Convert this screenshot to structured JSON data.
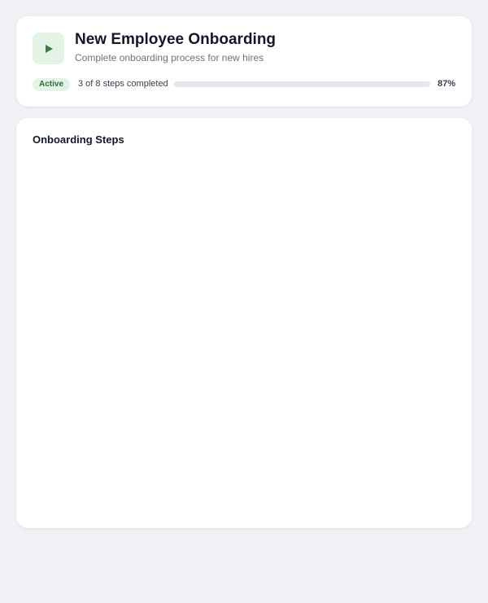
{
  "workflow": {
    "title": "New Employee Onboarding",
    "subtitle": "Complete onboarding process for new hires",
    "status": "Active",
    "steps_summary": "3 of 8 steps completed",
    "progress_percent_label": "87%",
    "progress_value": 0.87,
    "play_icon": "play-icon"
  },
  "steps_section": {
    "title": "Onboarding Steps",
    "items": []
  },
  "colors": {
    "accent_green": "#3b7a45",
    "badge_bg": "#e3f4e6",
    "badge_text": "#2e6b38",
    "page_bg": "#f0f1f5"
  }
}
